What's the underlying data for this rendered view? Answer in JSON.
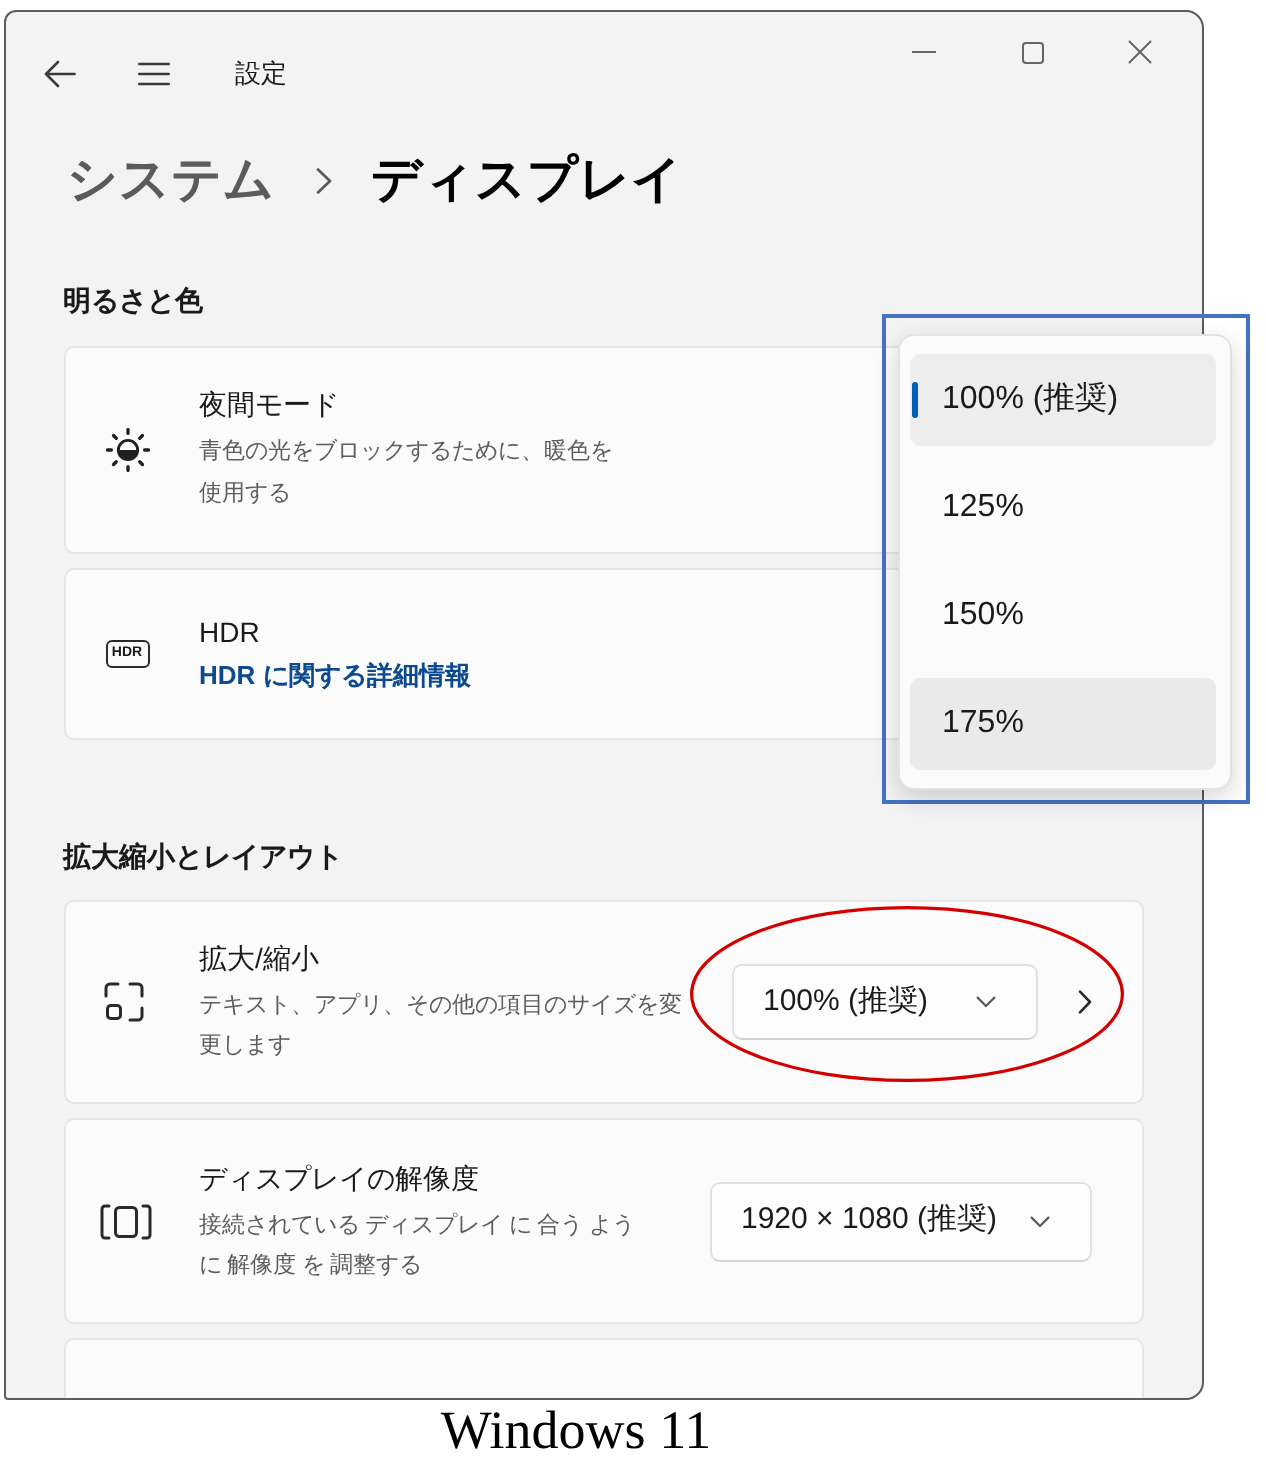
{
  "window": {
    "title": "設定"
  },
  "breadcrumb": [
    {
      "label": "システム",
      "current": false
    },
    {
      "label": "ディスプレイ",
      "current": true
    }
  ],
  "sections": [
    {
      "heading": "明るさと色",
      "cards": [
        {
          "kind": "night_light",
          "title": "夜間モード",
          "description": "青色の光をブロックするために、暖色を使用する",
          "subpage": false,
          "circled": false
        },
        {
          "kind": "hdr",
          "icon_label": "HDR",
          "title": "HDR",
          "link": "HDR に関する詳細情報",
          "subpage": false,
          "circled": false
        }
      ]
    },
    {
      "heading": "拡大縮小とレイアウト",
      "cards": [
        {
          "kind": "scale",
          "title": "拡大/縮小",
          "description": "テキスト、アプリ、その他の項目のサイズを変更します",
          "dropdown": "100% (推奨)",
          "subpage": true,
          "circled": true
        },
        {
          "kind": "resolution",
          "title": "ディスプレイの解像度",
          "description": "接続されている ディスプレイ に 合う ように 解像度 を 調整する",
          "dropdown": "1920 × 1080 (推奨)",
          "subpage": false,
          "circled": false
        }
      ]
    }
  ],
  "scale_menu": {
    "framed": true,
    "options": [
      {
        "label": "100% (推奨)",
        "selected": true,
        "highlighted": false
      },
      {
        "label": "125%",
        "selected": false,
        "highlighted": false
      },
      {
        "label": "150%",
        "selected": false,
        "highlighted": false
      },
      {
        "label": "175%",
        "selected": false,
        "highlighted": true
      }
    ]
  },
  "caption": "Windows 11"
}
